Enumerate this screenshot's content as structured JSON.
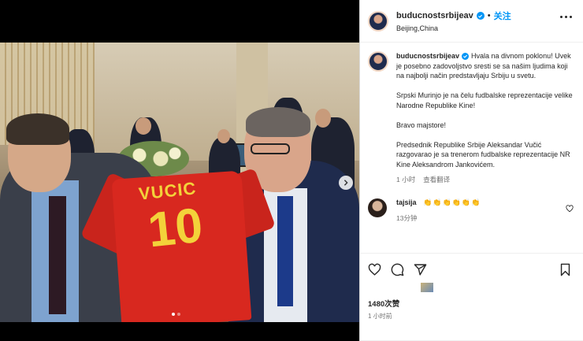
{
  "post": {
    "username": "buducnostsrbijeav",
    "follow_label": "关注",
    "dot": "•",
    "location": "Beijing,China",
    "caption": {
      "lead": "Hvala na divnom poklonu! Uvek je posebno zadovoljstvo sresti se sa našim ljudima koji na najbolji način predstavljaju Srbiju u svetu.",
      "p2": "Srpski Murinjo je na čelu fudbalske reprezentacije velike Narodne Republike Kine!",
      "p3": "Bravo majstore!",
      "p4": "Predsednik Republike Srbije Aleksandar Vučić razgovarao je sa trenerom fudbalske reprezentacije NR Kine Aleksandrom Jankovićem."
    },
    "caption_time": "1 小时",
    "translate_label": "查看翻译",
    "comment": {
      "username": "tajsija",
      "text": "👏👏👏👏👏👏",
      "time": "13分钟"
    },
    "views": "1480次赞",
    "posted_ago": "1 小时前"
  },
  "photo": {
    "jersey_name": "VUCIC",
    "jersey_number": "10"
  },
  "icons": {
    "more": "more-options-icon",
    "like": "heart-icon",
    "comment": "comment-icon",
    "share": "share-icon",
    "save": "bookmark-icon",
    "next": "chevron-right-icon",
    "verified": "verified-badge-icon"
  },
  "colors": {
    "accent": "#0095f6",
    "jersey_red": "#d8281f",
    "jersey_yellow": "#f3d23a"
  }
}
